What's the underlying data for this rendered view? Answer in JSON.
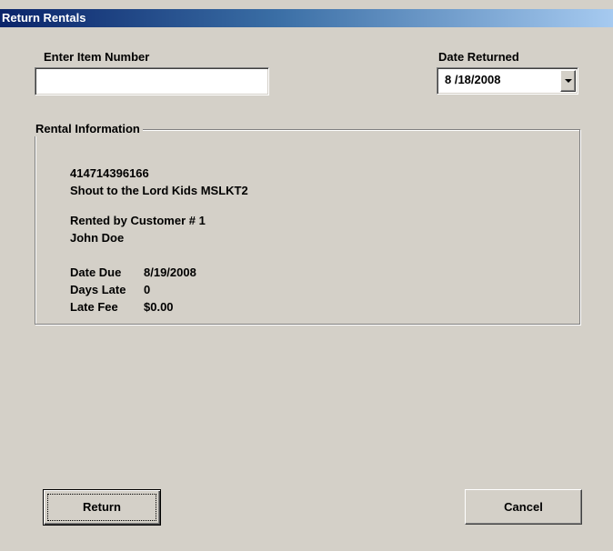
{
  "window": {
    "title": "Return Rentals"
  },
  "form": {
    "item_number_label": "Enter Item Number",
    "item_number_value": "",
    "date_returned_label": "Date Returned",
    "date_returned_value": "8 /18/2008"
  },
  "rental_info": {
    "group_title": "Rental Information",
    "item_number": "414714396166",
    "item_title": "Shout to the Lord Kids MSLKT2",
    "rented_by": "Rented by Customer # 1",
    "customer_name": "John Doe",
    "date_due_label": "Date Due",
    "date_due_value": "8/19/2008",
    "days_late_label": "Days Late",
    "days_late_value": "0",
    "late_fee_label": "Late Fee",
    "late_fee_value": "$0.00"
  },
  "buttons": {
    "return_label": "Return",
    "cancel_label": "Cancel"
  },
  "icons": {
    "dropdown": "chevron-down-icon"
  },
  "colors": {
    "titlebar_start": "#0a246a",
    "titlebar_end": "#a6caf0",
    "dialog_face": "#d4d0c8"
  }
}
